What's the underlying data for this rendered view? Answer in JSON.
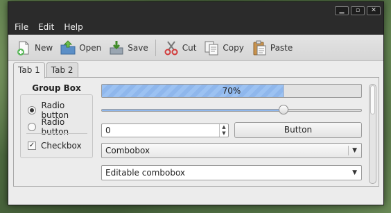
{
  "window": {
    "minimize_glyph": "▁",
    "maximize_glyph": "▫",
    "close_glyph": "✕"
  },
  "menu": [
    "File",
    "Edit",
    "Help"
  ],
  "toolbar": [
    {
      "label": "New",
      "icon": "new-icon"
    },
    {
      "label": "Open",
      "icon": "open-icon"
    },
    {
      "label": "Save",
      "icon": "save-icon"
    },
    {
      "label": "Cut",
      "icon": "cut-icon"
    },
    {
      "label": "Copy",
      "icon": "copy-icon"
    },
    {
      "label": "Paste",
      "icon": "paste-icon"
    }
  ],
  "tabs": [
    {
      "label": "Tab 1",
      "active": true
    },
    {
      "label": "Tab 2",
      "active": false
    }
  ],
  "group_box": {
    "title": "Group Box",
    "radio1": "Radio button",
    "radio2": "Radio button",
    "radio_selected": 1,
    "checkbox": "Checkbox",
    "checkbox_checked": true
  },
  "progress": {
    "value": 70,
    "text": "70%"
  },
  "slider": {
    "value": 0.7
  },
  "spinbox": {
    "value": "0"
  },
  "button": {
    "label": "Button"
  },
  "combobox": {
    "value": "Combobox"
  },
  "editable_combobox": {
    "value": "Editable combobox"
  },
  "colors": {
    "titlebar": "#2b2b2b",
    "progress_fill": "#9cc2f2",
    "window_bg": "#ececec"
  }
}
